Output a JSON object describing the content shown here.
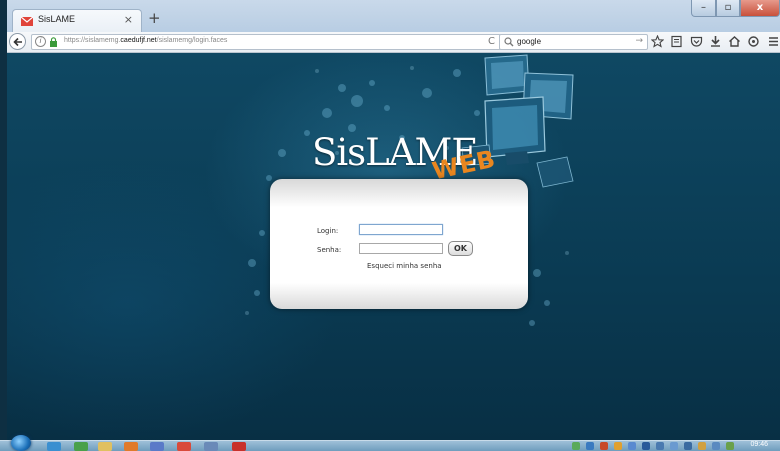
{
  "browser": {
    "tab": {
      "title": "SisLAME",
      "close_glyph": "×"
    },
    "new_tab_glyph": "+",
    "window_controls": {
      "minimize": "–",
      "maximize": "▫",
      "close": "x"
    },
    "address": {
      "prefix": "https://sislamemg.",
      "host": "caedufjf.net",
      "path": "/sislamemg/login.faces",
      "reload_glyph": "C"
    },
    "search": {
      "value": "google",
      "go_glyph": "→"
    }
  },
  "page": {
    "logo": {
      "main": "SisLAME",
      "accent": "WEB",
      "accent_color": "#e9861f"
    },
    "form": {
      "login_label": "Login:",
      "password_label": "Senha:",
      "login_value": "",
      "password_value": "",
      "submit_label": "OK",
      "forgot_link": "Esqueci minha senha"
    }
  },
  "taskbar": {
    "clock": "09:46"
  },
  "colors": {
    "background": "#0b3a52",
    "panel": "#ffffff",
    "accent": "#e9861f"
  }
}
